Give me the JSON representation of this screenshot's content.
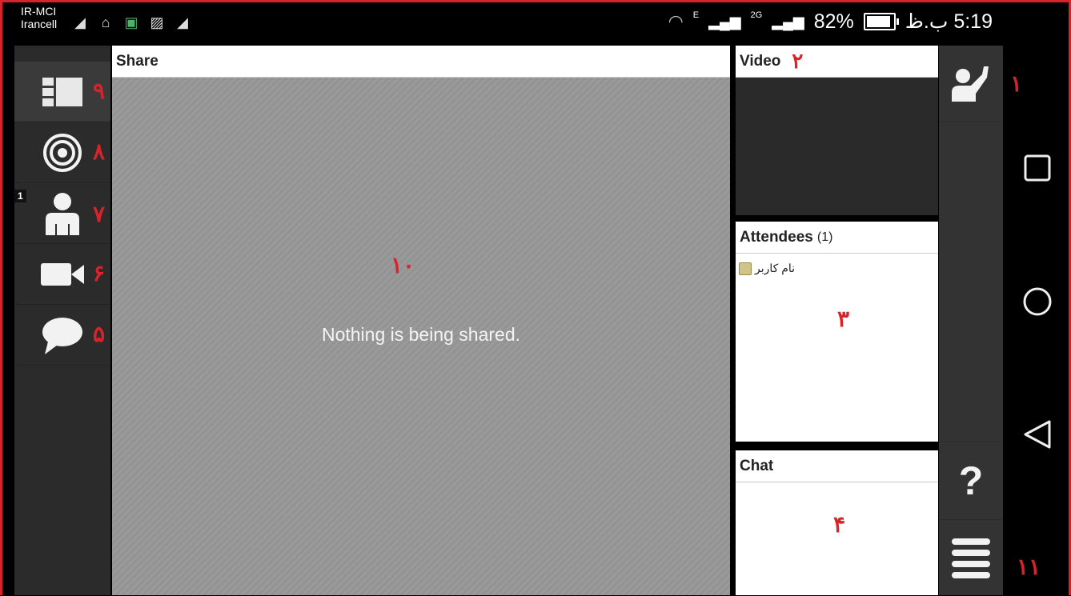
{
  "status_bar": {
    "carrier_line1": "IR-MCI",
    "carrier_line2": "Irancell",
    "network_e": "E",
    "network_2g": "2G",
    "battery_percent": "82%",
    "battery_level": 0.82,
    "time": "5:19 ب.ظ",
    "icons": [
      "signal-bars-icon",
      "notification-icon",
      "app-icon",
      "image-icon",
      "signal-bars-icon"
    ]
  },
  "left_toolbar": {
    "items": [
      {
        "icon": "layout-icon",
        "number": "۹"
      },
      {
        "icon": "broadcast-icon",
        "number": "۸"
      },
      {
        "icon": "attendee-icon",
        "number": "۷",
        "badge": "1"
      },
      {
        "icon": "video-camera-icon",
        "number": "۶"
      },
      {
        "icon": "chat-bubble-icon",
        "number": "۵"
      }
    ]
  },
  "share": {
    "title": "Share",
    "message": "Nothing is being shared.",
    "number": "۱۰"
  },
  "video": {
    "title": "Video",
    "number": "۲"
  },
  "attendees": {
    "title": "Attendees",
    "count": "(1)",
    "list": [
      {
        "name": "نام کاربر"
      }
    ],
    "number": "۳"
  },
  "chat": {
    "title": "Chat",
    "number": "۴"
  },
  "right_toolbar": {
    "raise_hand_number": "۱",
    "help_label": "?",
    "menu_number": "۱۱"
  },
  "colors": {
    "accent_red": "#d9232b",
    "toolbar_bg": "#2b2b2b"
  }
}
